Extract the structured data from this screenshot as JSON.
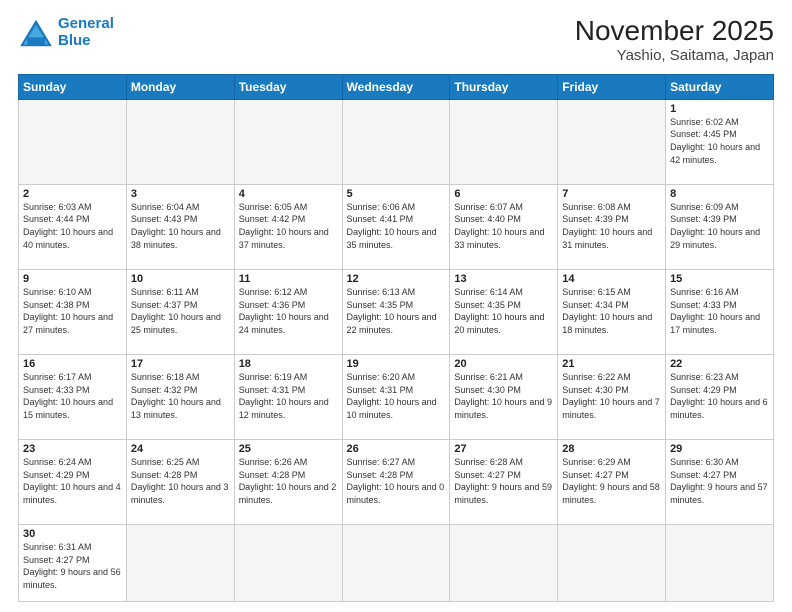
{
  "header": {
    "logo_line1": "General",
    "logo_line2": "Blue",
    "title": "November 2025",
    "subtitle": "Yashio, Saitama, Japan"
  },
  "weekdays": [
    "Sunday",
    "Monday",
    "Tuesday",
    "Wednesday",
    "Thursday",
    "Friday",
    "Saturday"
  ],
  "days": {
    "d1": {
      "num": "1",
      "rise": "6:02 AM",
      "set": "4:45 PM",
      "hours": "10 hours and 42 minutes."
    },
    "d2": {
      "num": "2",
      "rise": "6:03 AM",
      "set": "4:44 PM",
      "hours": "10 hours and 40 minutes."
    },
    "d3": {
      "num": "3",
      "rise": "6:04 AM",
      "set": "4:43 PM",
      "hours": "10 hours and 38 minutes."
    },
    "d4": {
      "num": "4",
      "rise": "6:05 AM",
      "set": "4:42 PM",
      "hours": "10 hours and 37 minutes."
    },
    "d5": {
      "num": "5",
      "rise": "6:06 AM",
      "set": "4:41 PM",
      "hours": "10 hours and 35 minutes."
    },
    "d6": {
      "num": "6",
      "rise": "6:07 AM",
      "set": "4:40 PM",
      "hours": "10 hours and 33 minutes."
    },
    "d7": {
      "num": "7",
      "rise": "6:08 AM",
      "set": "4:39 PM",
      "hours": "10 hours and 31 minutes."
    },
    "d8": {
      "num": "8",
      "rise": "6:09 AM",
      "set": "4:39 PM",
      "hours": "10 hours and 29 minutes."
    },
    "d9": {
      "num": "9",
      "rise": "6:10 AM",
      "set": "4:38 PM",
      "hours": "10 hours and 27 minutes."
    },
    "d10": {
      "num": "10",
      "rise": "6:11 AM",
      "set": "4:37 PM",
      "hours": "10 hours and 25 minutes."
    },
    "d11": {
      "num": "11",
      "rise": "6:12 AM",
      "set": "4:36 PM",
      "hours": "10 hours and 24 minutes."
    },
    "d12": {
      "num": "12",
      "rise": "6:13 AM",
      "set": "4:35 PM",
      "hours": "10 hours and 22 minutes."
    },
    "d13": {
      "num": "13",
      "rise": "6:14 AM",
      "set": "4:35 PM",
      "hours": "10 hours and 20 minutes."
    },
    "d14": {
      "num": "14",
      "rise": "6:15 AM",
      "set": "4:34 PM",
      "hours": "10 hours and 18 minutes."
    },
    "d15": {
      "num": "15",
      "rise": "6:16 AM",
      "set": "4:33 PM",
      "hours": "10 hours and 17 minutes."
    },
    "d16": {
      "num": "16",
      "rise": "6:17 AM",
      "set": "4:33 PM",
      "hours": "10 hours and 15 minutes."
    },
    "d17": {
      "num": "17",
      "rise": "6:18 AM",
      "set": "4:32 PM",
      "hours": "10 hours and 13 minutes."
    },
    "d18": {
      "num": "18",
      "rise": "6:19 AM",
      "set": "4:31 PM",
      "hours": "10 hours and 12 minutes."
    },
    "d19": {
      "num": "19",
      "rise": "6:20 AM",
      "set": "4:31 PM",
      "hours": "10 hours and 10 minutes."
    },
    "d20": {
      "num": "20",
      "rise": "6:21 AM",
      "set": "4:30 PM",
      "hours": "10 hours and 9 minutes."
    },
    "d21": {
      "num": "21",
      "rise": "6:22 AM",
      "set": "4:30 PM",
      "hours": "10 hours and 7 minutes."
    },
    "d22": {
      "num": "22",
      "rise": "6:23 AM",
      "set": "4:29 PM",
      "hours": "10 hours and 6 minutes."
    },
    "d23": {
      "num": "23",
      "rise": "6:24 AM",
      "set": "4:29 PM",
      "hours": "10 hours and 4 minutes."
    },
    "d24": {
      "num": "24",
      "rise": "6:25 AM",
      "set": "4:28 PM",
      "hours": "10 hours and 3 minutes."
    },
    "d25": {
      "num": "25",
      "rise": "6:26 AM",
      "set": "4:28 PM",
      "hours": "10 hours and 2 minutes."
    },
    "d26": {
      "num": "26",
      "rise": "6:27 AM",
      "set": "4:28 PM",
      "hours": "10 hours and 0 minutes."
    },
    "d27": {
      "num": "27",
      "rise": "6:28 AM",
      "set": "4:27 PM",
      "hours": "9 hours and 59 minutes."
    },
    "d28": {
      "num": "28",
      "rise": "6:29 AM",
      "set": "4:27 PM",
      "hours": "9 hours and 58 minutes."
    },
    "d29": {
      "num": "29",
      "rise": "6:30 AM",
      "set": "4:27 PM",
      "hours": "9 hours and 57 minutes."
    },
    "d30": {
      "num": "30",
      "rise": "6:31 AM",
      "set": "4:27 PM",
      "hours": "9 hours and 56 minutes."
    }
  }
}
